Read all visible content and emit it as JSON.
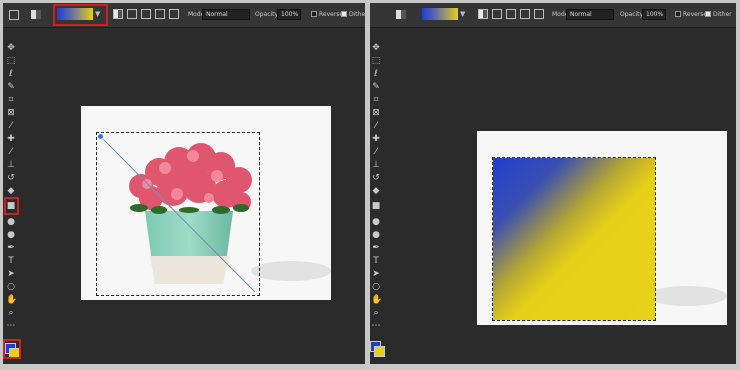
{
  "options_bar": {
    "mode_label": "Mode:",
    "mode_value": "Normal",
    "opacity_label": "Opacity:",
    "opacity_value": "100%",
    "reverse_label": "Reverse",
    "dither_label": "Dither",
    "reverse_checked": false,
    "dither_checked": true
  },
  "gradient": {
    "start_color": "#1d3fd0",
    "end_color": "#e6cf17"
  },
  "colors": {
    "foreground": "#1d3fd0",
    "background": "#e6cf17",
    "highlight": "#d01f1f"
  },
  "tools": [
    "move-icon",
    "marquee-icon",
    "lasso-icon",
    "quick-select-icon",
    "crop-icon",
    "frame-icon",
    "eyedropper-icon",
    "healing-icon",
    "brush-icon",
    "stamp-icon",
    "history-brush-icon",
    "eraser-icon",
    "gradient-icon",
    "blur-icon",
    "dodge-icon",
    "pen-icon",
    "type-icon",
    "path-select-icon",
    "shape-icon",
    "hand-icon",
    "zoom-icon",
    "more-icon"
  ],
  "left_panel": {
    "selected_tool": "gradient-icon",
    "image": "flowerpot photo with gradient drag line"
  },
  "right_panel": {
    "image": "blue-to-yellow linear gradient fill"
  }
}
